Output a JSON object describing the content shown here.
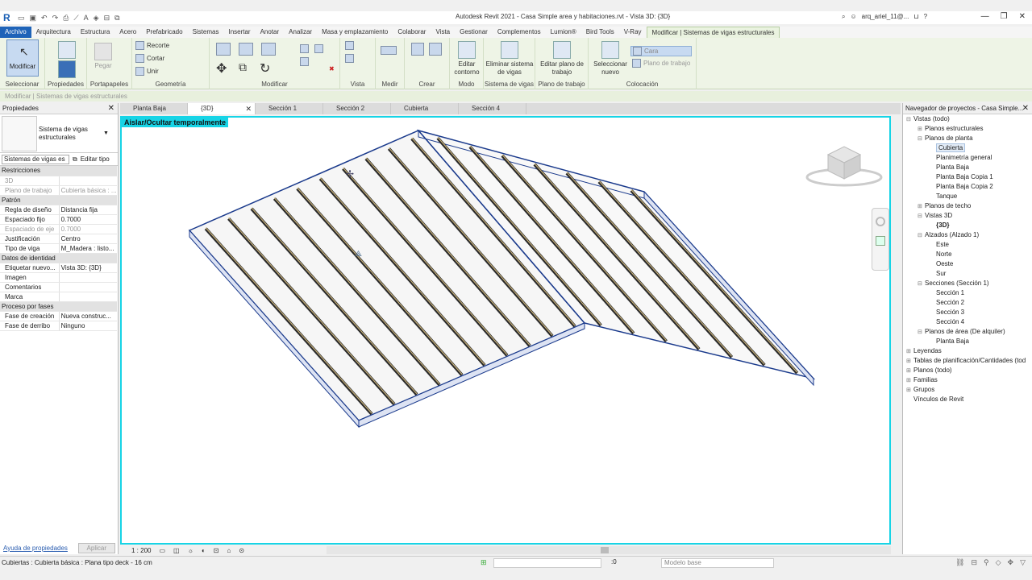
{
  "app": {
    "title": "Autodesk Revit 2021 - Casa Simple area y habitaciones.rvt - Vista 3D: {3D}",
    "user": "arq_ariel_11@..."
  },
  "ribbon_tabs": [
    "Archivo",
    "Arquitectura",
    "Estructura",
    "Acero",
    "Prefabricado",
    "Sistemas",
    "Insertar",
    "Anotar",
    "Analizar",
    "Masa y emplazamiento",
    "Colaborar",
    "Vista",
    "Gestionar",
    "Complementos",
    "Lumion®",
    "Bird Tools",
    "V-Ray",
    "Modificar | Sistemas de vigas estructurales"
  ],
  "ribbon": {
    "modify_label": "Modificar",
    "select_label": "Seleccionar",
    "properties_label": "Propiedades",
    "paste_label": "Pegar",
    "clipboard_label": "Portapapeles",
    "cut_label": "Recorte",
    "cut2_label": "Cortar",
    "join_label": "Unir",
    "geometry_label": "Geometría",
    "modify_panel_label": "Modificar",
    "view_label": "Vista",
    "measure_label": "Medir",
    "create_label": "Crear",
    "edit_boundary": "Editar contorno",
    "mode_label": "Modo",
    "delete_beam_system": "Eliminar sistema de vigas",
    "beam_system_label": "Sistema de vigas",
    "edit_workplane": "Editar plano de trabajo",
    "workplane_label": "Plano de trabajo",
    "pick_new": "Seleccionar nuevo",
    "face_label": "Cara",
    "workplane_btn": "Plano de trabajo",
    "placement_label": "Colocación"
  },
  "context_bar": "Modificar | Sistemas de vigas estructurales",
  "properties": {
    "title": "Propiedades",
    "type_name": "Sistema de vigas estructurales",
    "filter": "Sistemas de vigas es",
    "edit_type": "Editar tipo",
    "groups": [
      {
        "name": "Restricciones",
        "rows": [
          {
            "label": "3D",
            "value": "",
            "dim": true
          },
          {
            "label": "Plano de trabajo",
            "value": "Cubierta básica : ...",
            "dim": true
          }
        ]
      },
      {
        "name": "Patrón",
        "rows": [
          {
            "label": "Regla de diseño",
            "value": "Distancia fija",
            "dim": false
          },
          {
            "label": "Espaciado fijo",
            "value": "0.7000",
            "dim": false
          },
          {
            "label": "Espaciado de eje",
            "value": "0.7000",
            "dim": true
          },
          {
            "label": "Justificación",
            "value": "Centro",
            "dim": false
          },
          {
            "label": "Tipo de viga",
            "value": "M_Madera : listo...",
            "dim": false
          }
        ]
      },
      {
        "name": "Datos de identidad",
        "rows": [
          {
            "label": "Etiquetar nuevo...",
            "value": "Vista 3D: {3D}",
            "dim": false
          },
          {
            "label": "Imagen",
            "value": "",
            "dim": false
          },
          {
            "label": "Comentarios",
            "value": "",
            "dim": false
          },
          {
            "label": "Marca",
            "value": "",
            "dim": false
          }
        ]
      },
      {
        "name": "Proceso por fases",
        "rows": [
          {
            "label": "Fase de creación",
            "value": "Nueva construc...",
            "dim": false
          },
          {
            "label": "Fase de derribo",
            "value": "Ninguno",
            "dim": false
          }
        ]
      }
    ],
    "help_link": "Ayuda de propiedades",
    "apply": "Aplicar"
  },
  "view_tabs": [
    {
      "label": "Planta Baja",
      "active": false
    },
    {
      "label": "{3D}",
      "active": true
    },
    {
      "label": "Sección 1",
      "active": false
    },
    {
      "label": "Sección 2",
      "active": false
    },
    {
      "label": "Cubierta",
      "active": false
    },
    {
      "label": "Sección 4",
      "active": false
    }
  ],
  "viewport": {
    "isolate_label": "Aislar/Ocultar temporalmente",
    "scale": "1 : 200"
  },
  "browser": {
    "title": "Navegador de proyectos - Casa Simple...",
    "tree": [
      {
        "label": "Vistas (todo)",
        "level": 0,
        "toggle": "−"
      },
      {
        "label": "Planos estructurales",
        "level": 1,
        "toggle": "+"
      },
      {
        "label": "Planos de planta",
        "level": 1,
        "toggle": "−"
      },
      {
        "label": "Cubierta",
        "level": 2,
        "toggle": "",
        "selected": true
      },
      {
        "label": "Planimetría general",
        "level": 2,
        "toggle": ""
      },
      {
        "label": "Planta Baja",
        "level": 2,
        "toggle": ""
      },
      {
        "label": "Planta Baja Copia 1",
        "level": 2,
        "toggle": ""
      },
      {
        "label": "Planta Baja Copia 2",
        "level": 2,
        "toggle": ""
      },
      {
        "label": "Tanque",
        "level": 2,
        "toggle": ""
      },
      {
        "label": "Planos de techo",
        "level": 1,
        "toggle": "+"
      },
      {
        "label": "Vistas 3D",
        "level": 1,
        "toggle": "−"
      },
      {
        "label": "{3D}",
        "level": 2,
        "toggle": "",
        "bold": true
      },
      {
        "label": "Alzados (Alzado 1)",
        "level": 1,
        "toggle": "−"
      },
      {
        "label": "Este",
        "level": 2,
        "toggle": ""
      },
      {
        "label": "Norte",
        "level": 2,
        "toggle": ""
      },
      {
        "label": "Oeste",
        "level": 2,
        "toggle": ""
      },
      {
        "label": "Sur",
        "level": 2,
        "toggle": ""
      },
      {
        "label": "Secciones (Sección 1)",
        "level": 1,
        "toggle": "−"
      },
      {
        "label": "Sección 1",
        "level": 2,
        "toggle": ""
      },
      {
        "label": "Sección 2",
        "level": 2,
        "toggle": ""
      },
      {
        "label": "Sección 3",
        "level": 2,
        "toggle": ""
      },
      {
        "label": "Sección 4",
        "level": 2,
        "toggle": ""
      },
      {
        "label": "Planos de área (De alquiler)",
        "level": 1,
        "toggle": "−"
      },
      {
        "label": "Planta Baja",
        "level": 2,
        "toggle": ""
      },
      {
        "label": "Leyendas",
        "level": 0,
        "toggle": "+"
      },
      {
        "label": "Tablas de planificación/Cantidades (tod",
        "level": 0,
        "toggle": "+"
      },
      {
        "label": "Planos (todo)",
        "level": 0,
        "toggle": "+"
      },
      {
        "label": "Familias",
        "level": 0,
        "toggle": "+"
      },
      {
        "label": "Grupos",
        "level": 0,
        "toggle": "+"
      },
      {
        "label": "Vínculos de Revit",
        "level": 0,
        "toggle": ""
      }
    ]
  },
  "statusbar": {
    "message": "Cubiertas : Cubierta básica : Plana tipo deck - 16 cm",
    "zero": ":0",
    "model": "Modelo base"
  },
  "colors": {
    "accent": "#1e63b8",
    "isolate_border": "#17d4e6",
    "roof_edge": "#1a3a8c",
    "beam": "#2a2a2a",
    "beam_highlight": "#c9b27a"
  }
}
